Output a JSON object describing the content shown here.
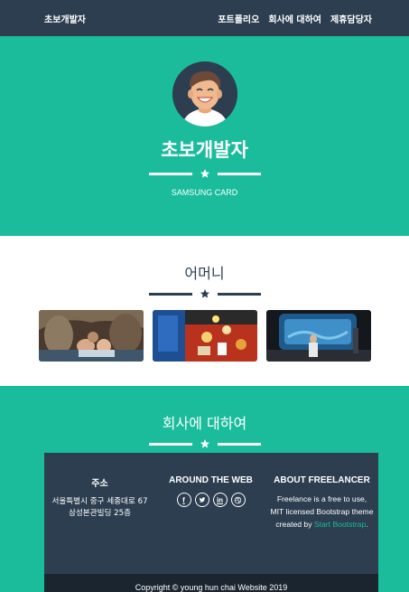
{
  "navbar": {
    "brand": "초보개발자",
    "links": [
      "포트폴리오",
      "회사에 대하여",
      "제휴담당자"
    ]
  },
  "masthead": {
    "title": "초보개발자",
    "subtitle": "SAMSUNG CARD"
  },
  "portfolio": {
    "title": "어머니",
    "photos": [
      "photo-1",
      "photo-2",
      "photo-3"
    ]
  },
  "about": {
    "title": "회사에 대하여"
  },
  "footer": {
    "location": {
      "heading": "주소",
      "line1": "서울특별시 중구 세종대로 67",
      "line2": "삼성본관빌딩 25층"
    },
    "web": {
      "heading": "AROUND THE WEB",
      "icons": [
        "facebook-icon",
        "twitter-icon",
        "linkedin-icon",
        "dribbble-icon"
      ]
    },
    "freelancer": {
      "heading": "ABOUT FREELANCER",
      "text": "Freelance is a free to use, MIT licensed Bootstrap theme created by",
      "link": "Start Bootstrap",
      "end": "."
    },
    "copyright": "Copyright © young hun chai Website 2019"
  },
  "colors": {
    "primary": "#2c3e50",
    "accent": "#1abc9c",
    "white": "#ffffff"
  }
}
